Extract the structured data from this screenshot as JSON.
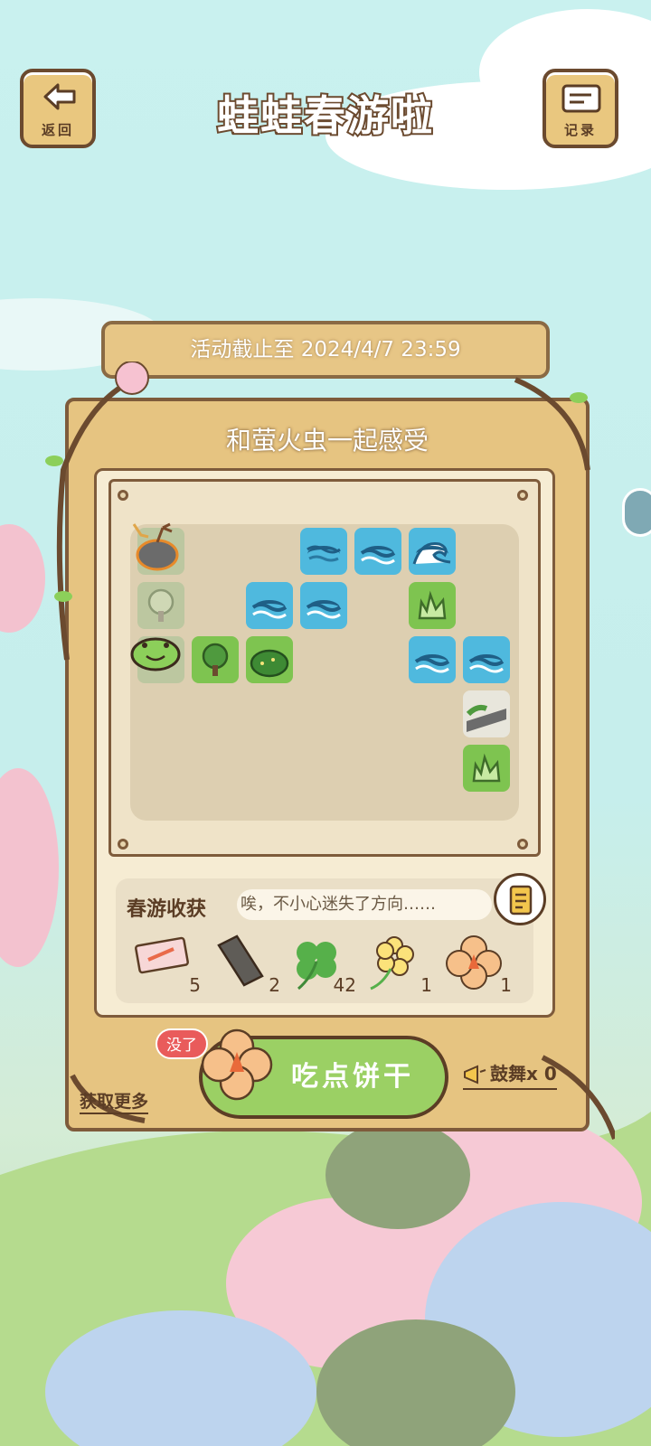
{
  "header": {
    "back_label": "返回",
    "title": "蛙蛙春游啦",
    "record_label": "记录"
  },
  "event": {
    "deadline": "活动截止至 2024/4/7 23:59",
    "stage_title": "和萤火虫一起感受"
  },
  "board": {
    "tiles": [
      {
        "type": "firefly-rock",
        "col": 0,
        "row": 0
      },
      {
        "type": "water-shallow",
        "col": 3,
        "row": 0
      },
      {
        "type": "water",
        "col": 4,
        "row": 0
      },
      {
        "type": "wave",
        "col": 5,
        "row": 0
      },
      {
        "type": "tree-faded",
        "col": 0,
        "row": 1
      },
      {
        "type": "water",
        "col": 2,
        "row": 1
      },
      {
        "type": "water",
        "col": 3,
        "row": 1
      },
      {
        "type": "grass",
        "col": 5,
        "row": 1
      },
      {
        "type": "frog",
        "col": 0,
        "row": 2
      },
      {
        "type": "tree",
        "col": 1,
        "row": 2
      },
      {
        "type": "bush",
        "col": 2,
        "row": 2
      },
      {
        "type": "water",
        "col": 5,
        "row": 2
      },
      {
        "type": "water",
        "col": 6,
        "row": 2
      },
      {
        "type": "road",
        "col": 6,
        "row": 3
      },
      {
        "type": "grass",
        "col": 6,
        "row": 4
      }
    ]
  },
  "harvest": {
    "label": "春游收获",
    "ticker": "唉，不小心迷失了方向……",
    "items": [
      {
        "name": "ticket",
        "icon": "ticket-icon",
        "count": "5"
      },
      {
        "name": "wood",
        "icon": "wood-icon",
        "count": "2"
      },
      {
        "name": "clover",
        "icon": "clover-icon",
        "count": "42"
      },
      {
        "name": "yellow-flower",
        "icon": "flower-icon",
        "count": "1"
      },
      {
        "name": "cookie",
        "icon": "cookie-icon",
        "count": "1"
      }
    ]
  },
  "actions": {
    "eat_label": "吃点饼干",
    "out_badge": "没了",
    "get_more": "获取更多",
    "drum_label": "鼓舞",
    "drum_count": "x 0"
  },
  "colors": {
    "wood": "#e6c481",
    "outline": "#7e5b3b",
    "water": "#4fb9de",
    "grass": "#7ec450",
    "button_green": "#9bd064",
    "badge_red": "#e95b5b"
  }
}
